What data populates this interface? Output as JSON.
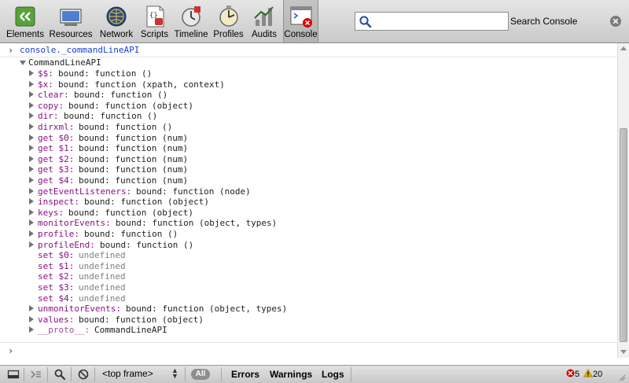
{
  "toolbar": {
    "tabs": [
      {
        "label": "Elements",
        "icon": "elements-icon"
      },
      {
        "label": "Resources",
        "icon": "resources-icon"
      },
      {
        "label": "Network",
        "icon": "network-icon"
      },
      {
        "label": "Scripts",
        "icon": "scripts-icon"
      },
      {
        "label": "Timeline",
        "icon": "timeline-icon"
      },
      {
        "label": "Profiles",
        "icon": "profiles-icon"
      },
      {
        "label": "Audits",
        "icon": "audits-icon"
      },
      {
        "label": "Console",
        "icon": "console-icon",
        "active": true
      }
    ],
    "search": {
      "value": "",
      "label": "Search Console"
    }
  },
  "console": {
    "command": "console._commandLineAPI",
    "object_name": "CommandLineAPI",
    "properties": [
      {
        "name": "$$:",
        "value": "bound: function ()",
        "expandable": true
      },
      {
        "name": "$x:",
        "value": "bound: function (xpath, context)",
        "expandable": true
      },
      {
        "name": "clear:",
        "value": "bound: function ()",
        "expandable": true
      },
      {
        "name": "copy:",
        "value": "bound: function (object)",
        "expandable": true
      },
      {
        "name": "dir:",
        "value": "bound: function ()",
        "expandable": true
      },
      {
        "name": "dirxml:",
        "value": "bound: function ()",
        "expandable": true
      },
      {
        "name": "get $0:",
        "value": "bound: function (num)",
        "expandable": true
      },
      {
        "name": "get $1:",
        "value": "bound: function (num)",
        "expandable": true
      },
      {
        "name": "get $2:",
        "value": "bound: function (num)",
        "expandable": true
      },
      {
        "name": "get $3:",
        "value": "bound: function (num)",
        "expandable": true
      },
      {
        "name": "get $4:",
        "value": "bound: function (num)",
        "expandable": true
      },
      {
        "name": "getEventListeners:",
        "value": "bound: function (node)",
        "expandable": true
      },
      {
        "name": "inspect:",
        "value": "bound: function (object)",
        "expandable": true
      },
      {
        "name": "keys:",
        "value": "bound: function (object)",
        "expandable": true
      },
      {
        "name": "monitorEvents:",
        "value": "bound: function (object, types)",
        "expandable": true
      },
      {
        "name": "profile:",
        "value": "bound: function ()",
        "expandable": true
      },
      {
        "name": "profileEnd:",
        "value": "bound: function ()",
        "expandable": true
      },
      {
        "name": "set $0:",
        "value": "undefined",
        "expandable": false
      },
      {
        "name": "set $1:",
        "value": "undefined",
        "expandable": false
      },
      {
        "name": "set $2:",
        "value": "undefined",
        "expandable": false
      },
      {
        "name": "set $3:",
        "value": "undefined",
        "expandable": false
      },
      {
        "name": "set $4:",
        "value": "undefined",
        "expandable": false
      },
      {
        "name": "unmonitorEvents:",
        "value": "bound: function (object, types)",
        "expandable": true
      },
      {
        "name": "values:",
        "value": "bound: function (object)",
        "expandable": true
      },
      {
        "name": "__proto__:",
        "value": "CommandLineAPI",
        "expandable": true,
        "proto": true
      }
    ]
  },
  "statusbar": {
    "frame": "<top frame>",
    "all_label": "All",
    "filters": [
      "Errors",
      "Warnings",
      "Logs"
    ],
    "error_count": "5",
    "warning_count": "20"
  },
  "colors": {
    "prompt": "#1a3fd3",
    "property_name": "#881280",
    "undefined": "#808080",
    "error": "#d00000",
    "warning": "#e0a800"
  }
}
